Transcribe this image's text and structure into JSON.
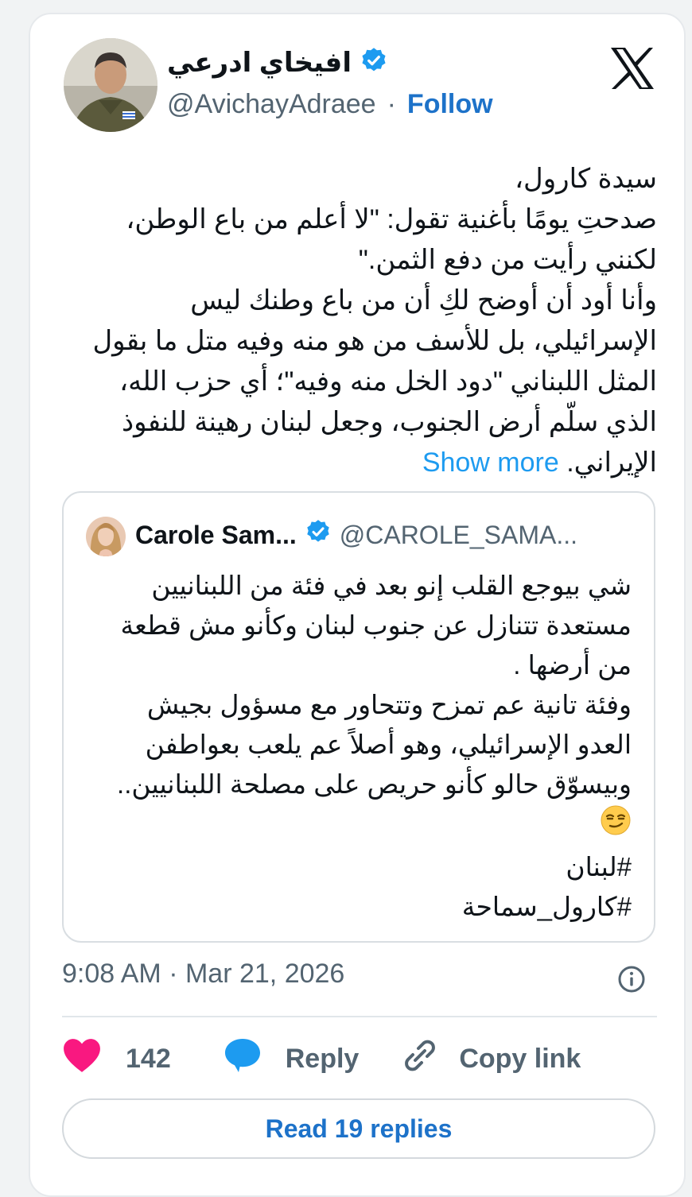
{
  "author": {
    "name": "افيخاي ادرعي",
    "handle": "@AvichayAdraee",
    "separator": "·",
    "follow_label": "Follow"
  },
  "tweet": {
    "text": "سيدة كارول،\nصدحتِ يومًا بأغنية تقول: \"لا أعلم من باع الوطن، لكنني رأيت من دفع الثمن.\"\nوأنا أود أن أوضح لكِ أن من باع وطنك ليس الإسرائيلي، بل للأسف من هو منه وفيه متل ما بقول المثل اللبناني \"دود الخل منه وفيه\"؛ أي حزب الله، الذي سلّم أرض الجنوب، وجعل لبنان رهينة للنفوذ الإيراني.",
    "show_more": "Show more"
  },
  "quoted": {
    "name": "Carole Sam...",
    "handle": "@CAROLE_SAMA...",
    "text": "شي بيوجع القلب إنو بعد في فئة من اللبنانيين مستعدة تتنازل عن جنوب لبنان وكأنو مش قطعة من أرضها .\nوفئة تانية عم تمزح وتتحاور مع مسؤول بجيش العدو الإسرائيلي، وهو أصلاً عم يلعب بعواطفن وبيسوّق حالو كأنو حريص على مصلحة اللبنانيين..",
    "hashtag1": "#لبنان",
    "hashtag2": "#كارول_سماحة"
  },
  "meta": {
    "time": "9:08 AM",
    "separator": "·",
    "date": "Mar 21, 2026"
  },
  "actions": {
    "like_count": "142",
    "reply_label": "Reply",
    "copy_label": "Copy link"
  },
  "footer": {
    "read_replies": "Read 19 replies"
  },
  "colors": {
    "accent": "#1d72c9",
    "verified": "#1d9bf0",
    "heart": "#f91880",
    "reply_bubble": "#1d9bf0",
    "muted": "#536471"
  },
  "icons": {
    "verified": "verified-badge-icon",
    "logo": "x-logo-icon",
    "info": "info-icon",
    "like": "heart-icon",
    "reply": "speech-bubble-icon",
    "copy": "link-icon",
    "emoji": "smirking-face-emoji"
  }
}
